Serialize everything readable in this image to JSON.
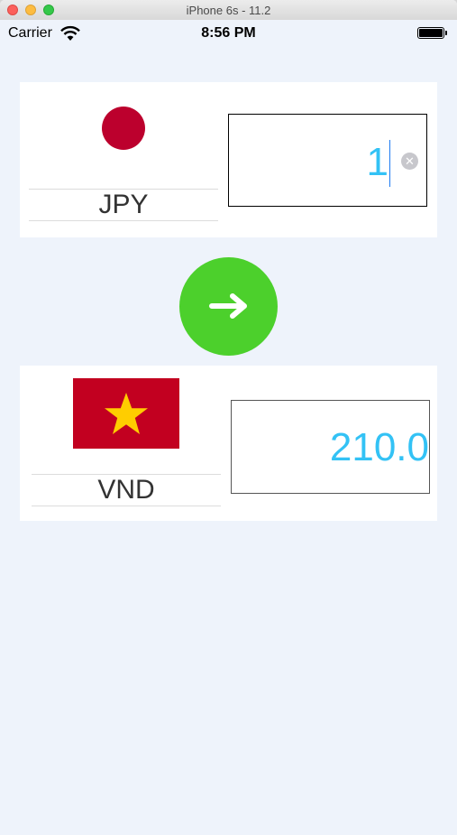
{
  "window": {
    "title": "iPhone 6s - 11.2"
  },
  "status_bar": {
    "carrier": "Carrier",
    "time": "8:56 PM"
  },
  "from_currency": {
    "code": "JPY",
    "amount": "1",
    "flag": "japan-flag-icon"
  },
  "convert": {
    "icon": "arrow-right-icon"
  },
  "to_currency": {
    "code": "VND",
    "amount": "210.0",
    "flag": "vietnam-flag-icon"
  },
  "colors": {
    "background": "#eef3fb",
    "amount_text": "#33c2f5",
    "convert_button": "#4cd02c",
    "japan_red": "#bc002d",
    "vietnam_red": "#c20020",
    "vietnam_star": "#ffcd00"
  }
}
